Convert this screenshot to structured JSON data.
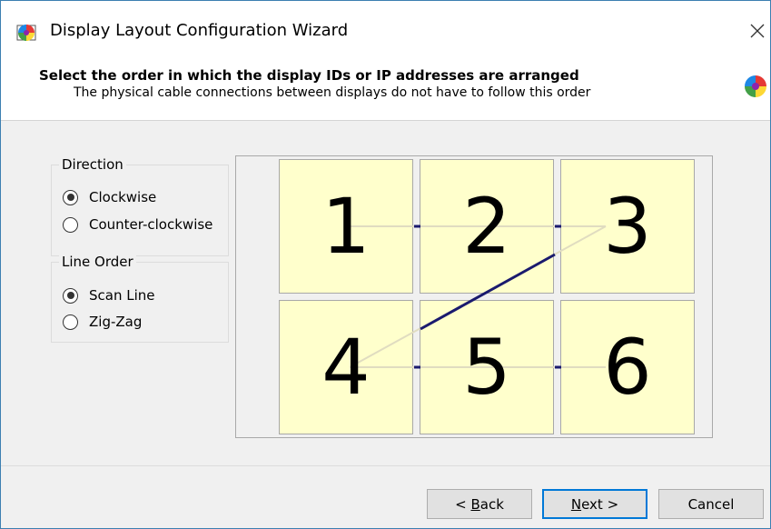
{
  "window": {
    "title": "Display Layout Configuration Wizard",
    "close_label": "×"
  },
  "header": {
    "title": "Select the order in which the display IDs or IP addresses are arranged",
    "subtitle": "The physical cable connections between displays do not have to follow this order"
  },
  "direction": {
    "label": "Direction",
    "options": [
      {
        "label": "Clockwise",
        "checked": true
      },
      {
        "label": "Counter-clockwise",
        "checked": false
      }
    ]
  },
  "line_order": {
    "label": "Line Order",
    "options": [
      {
        "label": "Scan Line",
        "checked": true
      },
      {
        "label": "Zig-Zag",
        "checked": false
      }
    ]
  },
  "grid": {
    "tiles": [
      "1",
      "2",
      "3",
      "4",
      "5",
      "6"
    ],
    "tile_color": "#ffffcc",
    "connection_color": "#1a1a6e",
    "path_color": "#e0dcc0"
  },
  "footer": {
    "back": {
      "mnemonic": "B",
      "rest": "ack"
    },
    "next": {
      "mnemonic": "N",
      "rest": "ext >"
    },
    "cancel": "Cancel",
    "back_prefix": "< "
  },
  "colors": {
    "accent": "#0078d7",
    "window_border": "#3c7fb1"
  }
}
